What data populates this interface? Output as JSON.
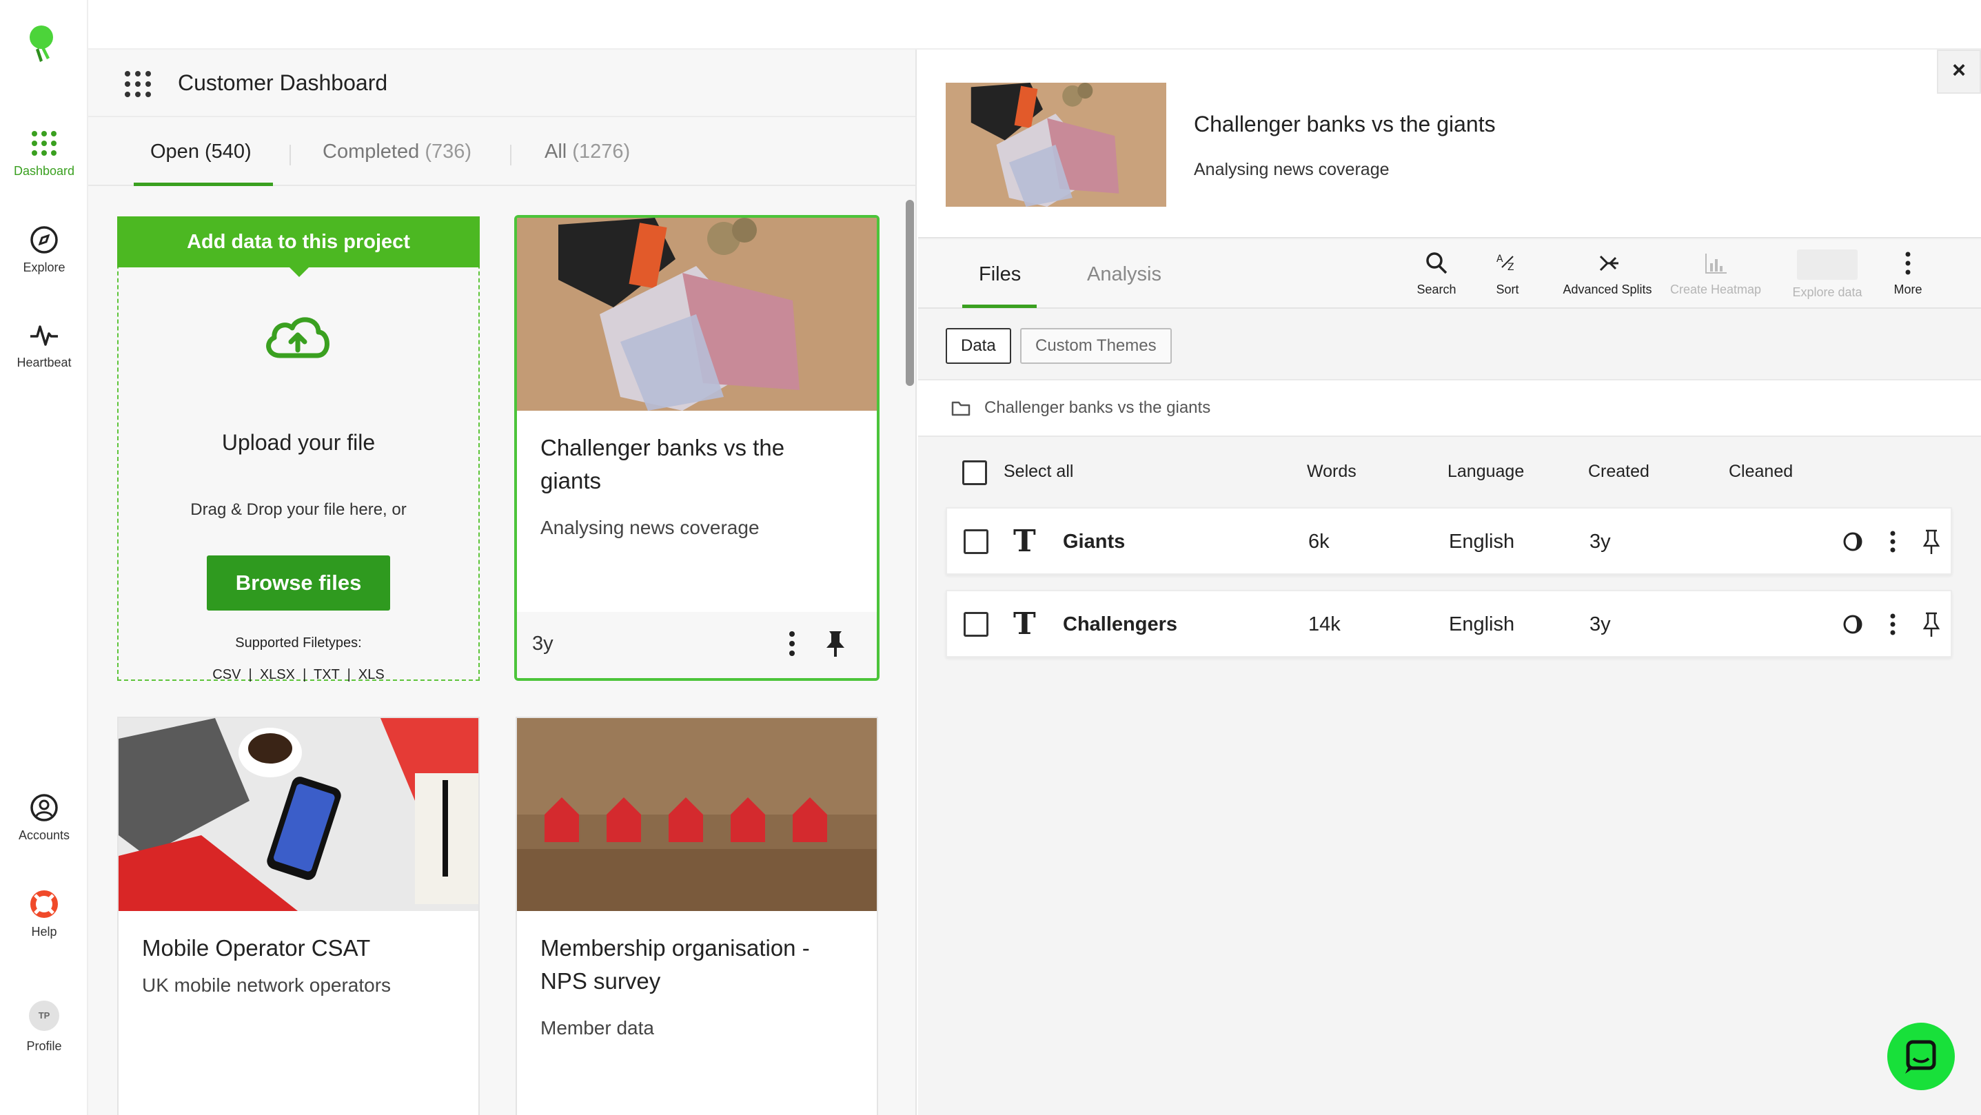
{
  "nav": {
    "items": [
      {
        "label": "Dashboard",
        "icon": "dots-grid-icon"
      },
      {
        "label": "Explore",
        "icon": "compass-icon"
      },
      {
        "label": "Heartbeat",
        "icon": "pulse-icon"
      },
      {
        "label": "Accounts",
        "icon": "user-circle-icon"
      },
      {
        "label": "Help",
        "icon": "lifebuoy-icon"
      },
      {
        "label": "Profile",
        "icon": "avatar-icon",
        "initials": "TP"
      }
    ],
    "active_color": "#3aa020"
  },
  "project": {
    "title": "Customer Dashboard",
    "tabs": [
      {
        "label": "Open",
        "count": "(540)"
      },
      {
        "label": "Completed",
        "count": "(736)"
      },
      {
        "label": "All",
        "count": "(1276)"
      }
    ]
  },
  "upload": {
    "header": "Add data to this project",
    "title": "Upload your file",
    "subtitle": "Drag & Drop your file here, or",
    "button": "Browse files",
    "filetypes_label": "Supported Filetypes:",
    "filetypes": "CSV  |  XLSX  |  TXT  |  XLS"
  },
  "cards": [
    {
      "title_line1": "Challenger banks vs the",
      "title_line2": "giants",
      "subtitle": "Analysing news coverage",
      "age": "3y",
      "selected": true
    },
    {
      "title_line1": "Mobile Operator CSAT",
      "title_line2": "",
      "subtitle": "UK mobile network operators"
    },
    {
      "title_line1": "Membership organisation -",
      "title_line2": "NPS survey",
      "subtitle": "Member data"
    }
  ],
  "detail": {
    "title": "Challenger banks vs the giants",
    "subtitle": "Analysing news coverage",
    "close": "×",
    "tabs": [
      "Files",
      "Analysis"
    ],
    "tools": [
      {
        "label": "Search",
        "icon": "search-icon",
        "enabled": true
      },
      {
        "label": "Sort",
        "icon": "sort-az-icon",
        "enabled": true
      },
      {
        "label": "Advanced Splits",
        "icon": "split-icon",
        "enabled": true
      },
      {
        "label": "Create Heatmap",
        "icon": "heatmap-icon",
        "enabled": false
      },
      {
        "label": "Explore data",
        "icon": "explore-data-icon",
        "enabled": false
      },
      {
        "label": "More",
        "icon": "kebab-icon",
        "enabled": true
      }
    ],
    "segments": [
      "Data",
      "Custom Themes"
    ],
    "breadcrumb": "Challenger banks vs the giants",
    "columns": [
      "Select all",
      "Words",
      "Language",
      "Created",
      "Cleaned"
    ],
    "rows": [
      {
        "type": "T",
        "name": "Giants",
        "words": "6k",
        "language": "English",
        "created": "3y"
      },
      {
        "type": "T",
        "name": "Challengers",
        "words": "14k",
        "language": "English",
        "created": "3y"
      }
    ]
  },
  "colors": {
    "brand_green": "#4cb822",
    "button_green": "#2f9a1f",
    "chat_green": "#18e03a"
  }
}
